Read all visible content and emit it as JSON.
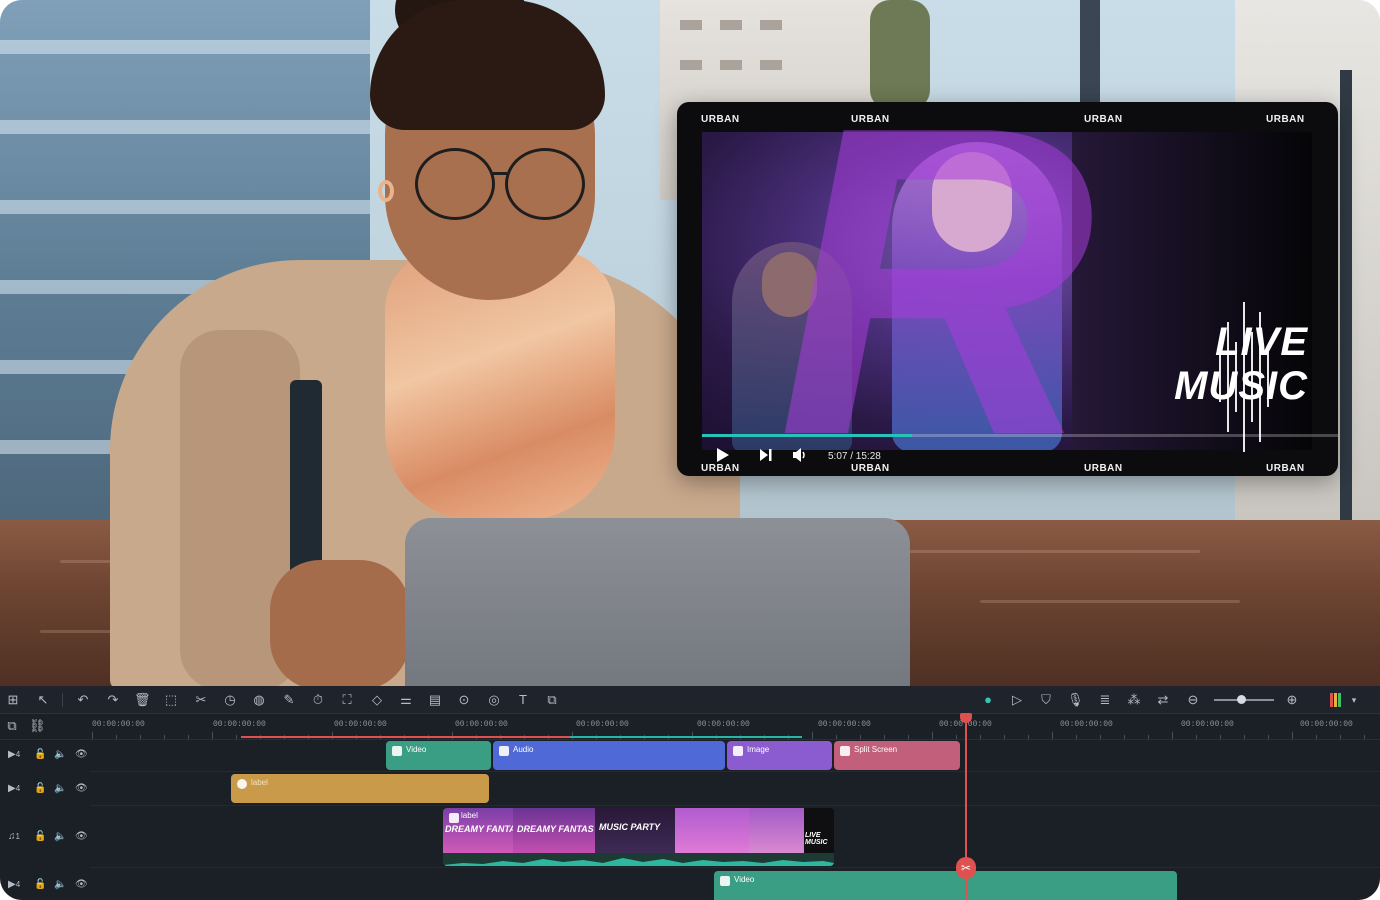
{
  "player": {
    "brand_text": "URBAN",
    "headline_line1": "LIVE",
    "headline_line2": "MUSIC",
    "time_display": "5:07 / 15:28",
    "progress_fraction": 0.33,
    "icons": {
      "play": "play-icon",
      "next": "skip-next-icon",
      "volume": "volume-icon"
    }
  },
  "toolbar": {
    "left_icons": [
      "layout-icon",
      "select-tool-icon",
      "undo-icon",
      "redo-icon",
      "delete-icon",
      "crop-icon",
      "cut-icon",
      "speed-icon",
      "color-icon",
      "edit-icon",
      "timer-icon",
      "fit-icon",
      "keyframe-icon",
      "adjust-icon",
      "split-audio-icon",
      "auto-icon",
      "stabilize-icon",
      "text-icon",
      "ai-text-icon"
    ],
    "right_icons": [
      "render-icon",
      "play-range-icon",
      "shield-icon",
      "mic-icon",
      "audio-list-icon",
      "snap-icon",
      "replace-icon",
      "zoom-out-icon",
      "zoom-in-icon",
      "meter-icon",
      "more-icon"
    ],
    "zoom_level_fraction": 0.45
  },
  "ruler": {
    "labels": [
      "00:00:00:00",
      "00:00:00:00",
      "00:00:00:00",
      "00:00:00:00",
      "00:00:00:00",
      "00:00:00:00",
      "00:00:00:00",
      "00:00:00:00",
      "00:00:00:00",
      "00:00:00:00",
      "00:00:00:00"
    ]
  },
  "tracks": [
    {
      "type_icon": "▶",
      "number": "4",
      "clips": [
        {
          "label": "Video",
          "color": "#3a9e84"
        },
        {
          "label": "Audio",
          "color": "#4f6ad6"
        },
        {
          "label": "Image",
          "color": "#8a5ccf"
        },
        {
          "label": "Split Screen",
          "color": "#c25f7a"
        }
      ]
    },
    {
      "type_icon": "▶",
      "number": "4",
      "clips": [
        {
          "label": "label",
          "color": "#c99a4a"
        }
      ]
    },
    {
      "type_icon": "♫",
      "number": "1",
      "clips": [
        {
          "label": "label",
          "color": "#3a9e84"
        }
      ]
    },
    {
      "type_icon": "▶",
      "number": "4",
      "clips": [
        {
          "label": "Video",
          "color": "#3a9e84"
        }
      ]
    }
  ],
  "filmstrip": {
    "thumb_texts": [
      "DREAMY FANTAS",
      "DREAMY FANTAS",
      "MUSIC PARTY",
      "LIVE MUSIC"
    ]
  },
  "colors": {
    "accent_teal": "#27c3b8",
    "playhead": "#e0504f",
    "editor_bg": "#1b1f26"
  }
}
